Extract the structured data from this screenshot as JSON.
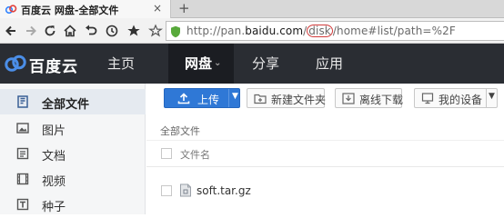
{
  "browser": {
    "tab_title": "百度云 网盘-全部文件",
    "tab_close_glyph": "×",
    "newtab_glyph": "+",
    "url": {
      "prefix": "http://pan.",
      "host": "baidu.com",
      "slash": "/",
      "highlight": "disk",
      "suffix": "/home#list/path=%2F"
    },
    "icons": [
      "back-icon",
      "forward-icon",
      "reload-icon",
      "home-icon",
      "undo-icon",
      "history-icon",
      "bookmark-star-icon",
      "url-star-icon",
      "security-shield-icon"
    ]
  },
  "app": {
    "logo_text": "百度云",
    "nav": [
      {
        "label": "主页"
      },
      {
        "label": "网盘",
        "caret": "⌄"
      },
      {
        "label": "分享"
      },
      {
        "label": "应用"
      }
    ]
  },
  "sidebar": {
    "items": [
      {
        "label": "全部文件",
        "icon": "all-files-icon"
      },
      {
        "label": "图片",
        "icon": "image-icon"
      },
      {
        "label": "文档",
        "icon": "document-icon"
      },
      {
        "label": "视频",
        "icon": "video-icon"
      },
      {
        "label": "种子",
        "icon": "torrent-icon"
      }
    ]
  },
  "toolbar": {
    "upload_label": "上传",
    "new_folder_label": "新建文件夹",
    "offline_download_label": "离线下载",
    "my_devices_label": "我的设备",
    "dropdown_glyph": "▼"
  },
  "breadcrumb": "全部文件",
  "list": {
    "column_name": "文件名",
    "rows": [
      {
        "name": "soft.tar.gz",
        "icon": "archive-file-icon"
      }
    ]
  },
  "colors": {
    "app_header": "#2a2d33",
    "upload_button": "#2f78d6",
    "url_highlight_circle": "#d23b3b"
  }
}
